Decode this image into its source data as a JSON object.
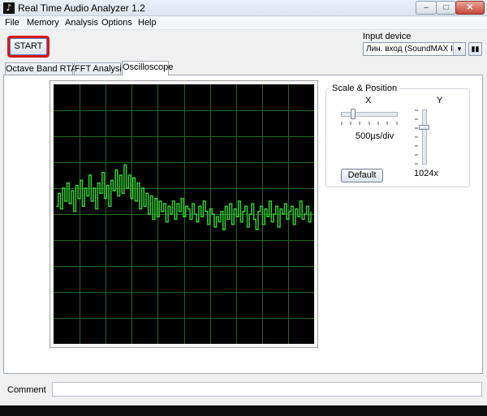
{
  "window": {
    "title": "Real Time Audio Analyzer 1.2",
    "app_icon": "music-note-icon",
    "controls": {
      "minimize": "–",
      "maximize": "□",
      "close": "✕"
    }
  },
  "menu": [
    "File",
    "Memory",
    "Analysis",
    "Options",
    "Help"
  ],
  "toolbar": {
    "start_label": "START"
  },
  "input_device": {
    "label": "Input device",
    "selected": "Лин. вход (SoundMAX Integ",
    "settings_icon": "device-settings-icon"
  },
  "tabs": [
    {
      "label": "Octave Band RTA",
      "active": false
    },
    {
      "label": "FFT Analysis",
      "active": false
    },
    {
      "label": "Oscilloscope",
      "active": true
    }
  ],
  "oscilloscope": {
    "background": "#000000",
    "grid_color": "#1d6b1d",
    "trace_color": "#33cc33",
    "grid_divisions": 10,
    "y_range": [
      -1,
      1
    ],
    "trace_samples": [
      0.06,
      0.16,
      0.04,
      0.2,
      0.1,
      0.24,
      0.08,
      0.18,
      0.02,
      0.22,
      0.12,
      0.26,
      0.06,
      0.2,
      0.14,
      0.3,
      0.1,
      0.2,
      0.04,
      0.24,
      0.16,
      0.32,
      0.12,
      0.22,
      0.06,
      0.26,
      0.18,
      0.34,
      0.14,
      0.3,
      0.16,
      0.38,
      0.2,
      0.3,
      0.12,
      0.28,
      0.1,
      0.24,
      0.04,
      0.2,
      0.06,
      0.16,
      0.0,
      0.14,
      -0.04,
      0.12,
      -0.02,
      0.1,
      0.02,
      0.08,
      -0.06,
      0.06,
      0.0,
      0.1,
      -0.04,
      0.08,
      0.02,
      0.12,
      -0.02,
      0.06,
      0.04,
      -0.04,
      0.08,
      0.0,
      -0.06,
      0.06,
      -0.02,
      0.1,
      0.02,
      -0.08,
      0.04,
      0.0,
      -0.1,
      -0.02,
      -0.06,
      0.02,
      -0.12,
      0.06,
      -0.04,
      0.08,
      -0.08,
      0.04,
      -0.02,
      0.1,
      -0.06,
      0.02,
      0.06,
      -0.1,
      0.0,
      0.08,
      -0.04,
      -0.12,
      0.02,
      0.06,
      -0.08,
      0.04,
      -0.02,
      0.1,
      -0.06,
      0.0,
      0.06,
      -0.1,
      0.04,
      0.0,
      0.08,
      -0.04,
      0.02,
      0.06,
      -0.08,
      0.04,
      -0.02,
      0.1,
      -0.04,
      0.0,
      0.06,
      -0.06,
      0.02
    ]
  },
  "scale_position": {
    "title": "Scale & Position",
    "x_label": "X",
    "y_label": "Y",
    "x_value": "500µs/div",
    "y_value": "1024x",
    "default_label": "Default"
  },
  "comment": {
    "label": "Comment",
    "value": ""
  }
}
